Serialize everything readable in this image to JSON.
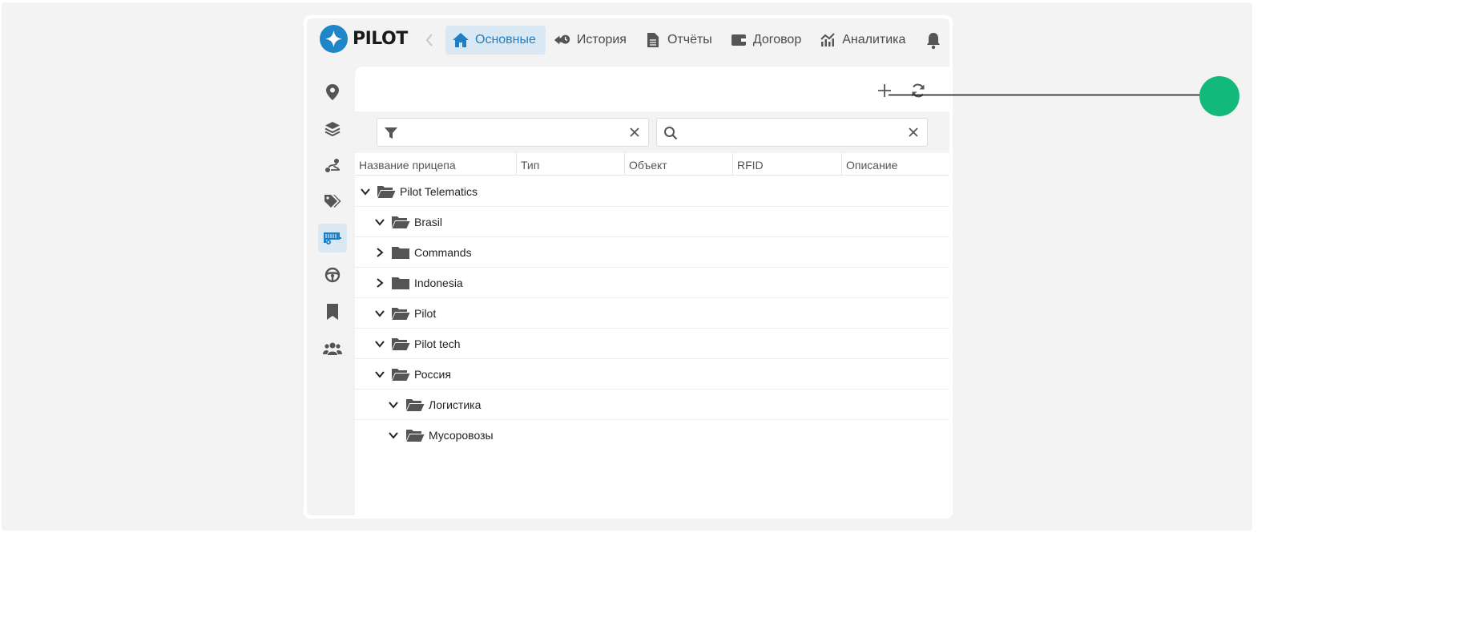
{
  "brand": {
    "name": "PILOT",
    "accent": "#1f86c8"
  },
  "nav": {
    "tabs": [
      {
        "label": "Основные",
        "icon": "home-icon",
        "active": true
      },
      {
        "label": "История",
        "icon": "history-icon",
        "active": false
      },
      {
        "label": "Отчёты",
        "icon": "report-icon",
        "active": false
      },
      {
        "label": "Договор",
        "icon": "wallet-icon",
        "active": false
      },
      {
        "label": "Аналитика",
        "icon": "analytics-icon",
        "active": false
      }
    ]
  },
  "sidebar": {
    "items": [
      {
        "icon": "map-marker-icon",
        "active": false
      },
      {
        "icon": "layers-icon",
        "active": false
      },
      {
        "icon": "route-icon",
        "active": false
      },
      {
        "icon": "tags-icon",
        "active": false
      },
      {
        "icon": "trailer-icon",
        "active": true
      },
      {
        "icon": "steering-wheel-icon",
        "active": false
      },
      {
        "icon": "bookmark-icon",
        "active": false
      },
      {
        "icon": "users-icon",
        "active": false
      }
    ]
  },
  "filter": {
    "value": "",
    "placeholder": ""
  },
  "search": {
    "value": "",
    "placeholder": ""
  },
  "table": {
    "columns": [
      "Название прицепа",
      "Тип",
      "Объект",
      "RFID",
      "Описание"
    ]
  },
  "tree": [
    {
      "label": "Pilot Telematics",
      "level": 0,
      "expanded": true
    },
    {
      "label": "Brasil",
      "level": 1,
      "expanded": true
    },
    {
      "label": "Commands",
      "level": 1,
      "expanded": false
    },
    {
      "label": "Indonesia",
      "level": 1,
      "expanded": false
    },
    {
      "label": "Pilot",
      "level": 1,
      "expanded": true
    },
    {
      "label": "Pilot tech",
      "level": 1,
      "expanded": true
    },
    {
      "label": "Россия",
      "level": 1,
      "expanded": true
    },
    {
      "label": "Логистика",
      "level": 2,
      "expanded": true
    },
    {
      "label": "Мусоровозы",
      "level": 2,
      "expanded": true
    }
  ],
  "colors": {
    "active_bg": "#d9e8f2",
    "active_text": "#1f7fc4",
    "icon_gray": "#555555",
    "annotation_dot": "#13b87b"
  }
}
